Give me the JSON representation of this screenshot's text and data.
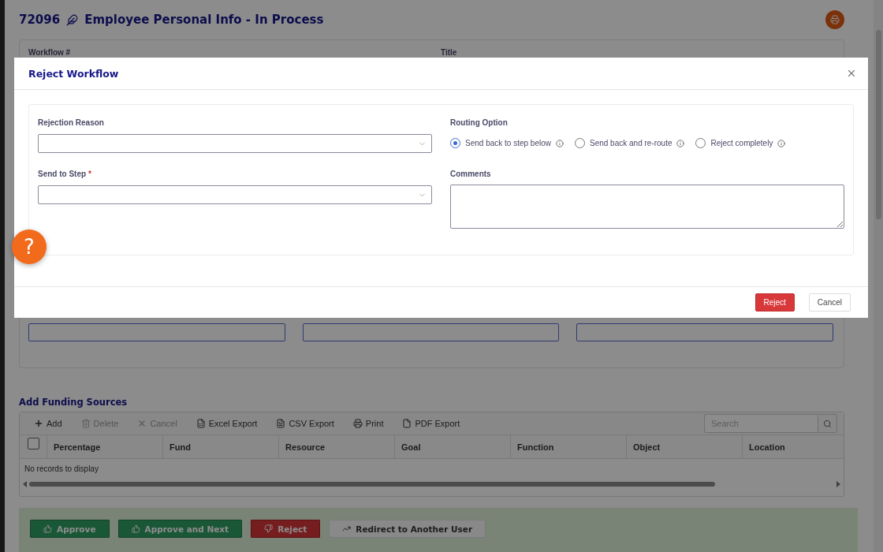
{
  "header": {
    "number": "72096",
    "title": "Employee Personal Info - In Process"
  },
  "summary_card": {
    "labels": [
      "Workflow #",
      "Title"
    ]
  },
  "funding": {
    "title": "Add Funding Sources",
    "toolbar": [
      {
        "label": "Add",
        "kind": "add",
        "disabled": false
      },
      {
        "label": "Delete",
        "kind": "delete",
        "disabled": true
      },
      {
        "label": "Cancel",
        "kind": "cancel",
        "disabled": true
      },
      {
        "label": "Excel Export",
        "kind": "excel",
        "disabled": false
      },
      {
        "label": "CSV Export",
        "kind": "csv",
        "disabled": false
      },
      {
        "label": "Print",
        "kind": "print",
        "disabled": false
      },
      {
        "label": "PDF Export",
        "kind": "pdf",
        "disabled": false
      }
    ],
    "search": {
      "placeholder": "Search"
    },
    "select_all": {
      "checked": false
    },
    "columns": [
      "Percentage",
      "Fund",
      "Resource",
      "Goal",
      "Function",
      "Object",
      "Location"
    ],
    "empty_message": "No records to display"
  },
  "actions": [
    {
      "label": "Approve",
      "kind": "approve"
    },
    {
      "label": "Approve and Next",
      "kind": "approve"
    },
    {
      "label": "Reject",
      "kind": "reject"
    },
    {
      "label": "Redirect to Another User",
      "kind": "redirect"
    }
  ],
  "modal": {
    "title": "Reject Workflow",
    "rejection_reason": {
      "label": "Rejection Reason"
    },
    "send_to_step": {
      "label": "Send to Step",
      "required_mark": "*"
    },
    "routing": {
      "label": "Routing Option",
      "options": [
        {
          "label": "Send back to step below",
          "selected": true
        },
        {
          "label": "Send back and re-route",
          "selected": false
        },
        {
          "label": "Reject completely",
          "selected": false
        }
      ]
    },
    "comments": {
      "label": "Comments"
    },
    "buttons": [
      {
        "label": "Reject",
        "kind": "primary"
      },
      {
        "label": "Cancel",
        "kind": "secondary"
      }
    ]
  },
  "help_button": {
    "label": "?"
  }
}
